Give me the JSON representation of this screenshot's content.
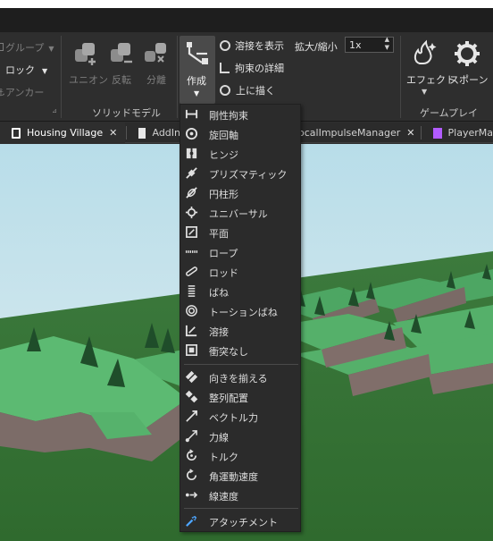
{
  "ribbon": {
    "group_button_label": "グループ",
    "lock_label": "ロック",
    "anchor_label": "アンカー",
    "union_label": "ユニオン",
    "negate_label": "反転",
    "separate_label": "分離",
    "solid_model_group": "ソリッドモデル",
    "create_label": "作成",
    "show_welds_label": "溶接を表示",
    "constraint_details_label": "拘束の詳細",
    "draw_on_top_label": "上に描く",
    "scale_label": "拡大/縮小",
    "scale_value": "1x",
    "effects_label": "エフェクト",
    "spawn_label": "スポーン",
    "gameplay_group": "ゲームプレイ"
  },
  "tabs": [
    {
      "label": "Housing Village",
      "close": "✕"
    },
    {
      "label": "AddIn",
      "close": ""
    },
    {
      "label": "ocalImpulseManager",
      "close": "✕"
    },
    {
      "label": "PlayerMa",
      "close": ""
    }
  ],
  "menu": {
    "items": [
      {
        "label": "剛性拘束",
        "icon": "rigid-constraint-icon"
      },
      {
        "label": "旋回軸",
        "icon": "hinge-pivot-icon"
      },
      {
        "label": "ヒンジ",
        "icon": "hinge-icon"
      },
      {
        "label": "プリズマティック",
        "icon": "prismatic-icon"
      },
      {
        "label": "円柱形",
        "icon": "cylindrical-icon"
      },
      {
        "label": "ユニバーサル",
        "icon": "universal-icon"
      },
      {
        "label": "平面",
        "icon": "plane-icon"
      },
      {
        "label": "ロープ",
        "icon": "rope-icon"
      },
      {
        "label": "ロッド",
        "icon": "rod-icon"
      },
      {
        "label": "ばね",
        "icon": "spring-icon"
      },
      {
        "label": "トーションばね",
        "icon": "torsion-spring-icon"
      },
      {
        "label": "溶接",
        "icon": "weld-icon"
      },
      {
        "label": "衝突なし",
        "icon": "no-collision-icon"
      },
      {
        "label": "向きを揃える",
        "icon": "align-orientation-icon"
      },
      {
        "label": "整列配置",
        "icon": "align-position-icon"
      },
      {
        "label": "ベクトル力",
        "icon": "vector-force-icon"
      },
      {
        "label": "力線",
        "icon": "line-force-icon"
      },
      {
        "label": "トルク",
        "icon": "torque-icon"
      },
      {
        "label": "角運動速度",
        "icon": "angular-velocity-icon"
      },
      {
        "label": "線速度",
        "icon": "linear-velocity-icon"
      },
      {
        "label": "アタッチメント",
        "icon": "attachment-icon"
      }
    ]
  }
}
